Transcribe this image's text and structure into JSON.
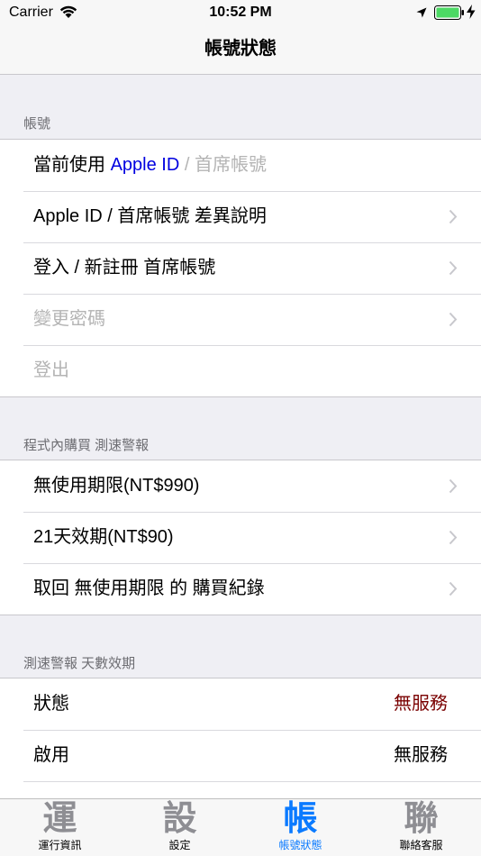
{
  "status_bar": {
    "carrier": "Carrier",
    "time": "10:52 PM"
  },
  "nav": {
    "title": "帳號狀態"
  },
  "account_section": {
    "header": "帳號",
    "current_prefix": "當前使用 ",
    "current_apple_id": "Apple ID",
    "current_separator": " / ",
    "current_premium": "首席帳號",
    "rows": [
      {
        "label": "Apple ID / 首席帳號 差異說明"
      },
      {
        "label": "登入 / 新註冊 首席帳號"
      },
      {
        "label": "變更密碼"
      },
      {
        "label": "登出"
      }
    ]
  },
  "iap_section": {
    "header": "程式內購買 測速警報",
    "rows": [
      {
        "label": "無使用期限(NT$990)"
      },
      {
        "label": "21天效期(NT$90)"
      },
      {
        "label": "取回 無使用期限 的 購買紀錄"
      }
    ]
  },
  "expiry_section": {
    "header": "測速警報 天數效期",
    "rows": [
      {
        "label": "狀態",
        "value": "無服務"
      },
      {
        "label": "啟用",
        "value": "無服務"
      }
    ]
  },
  "tab_bar": {
    "tabs": [
      {
        "glyph": "運",
        "label": "運行資訊"
      },
      {
        "glyph": "設",
        "label": "設定"
      },
      {
        "glyph": "帳",
        "label": "帳號狀態"
      },
      {
        "glyph": "聯",
        "label": "聯絡客服"
      }
    ]
  },
  "colors": {
    "tint": "#0a7aff",
    "link_blue": "#0000e0",
    "status_red": "#7a0000",
    "disabled_gray": "#b4b4b4"
  },
  "icons": [
    "wifi-icon",
    "location-arrow-icon",
    "battery-icon",
    "charging-bolt-icon",
    "chevron-right-icon"
  ]
}
